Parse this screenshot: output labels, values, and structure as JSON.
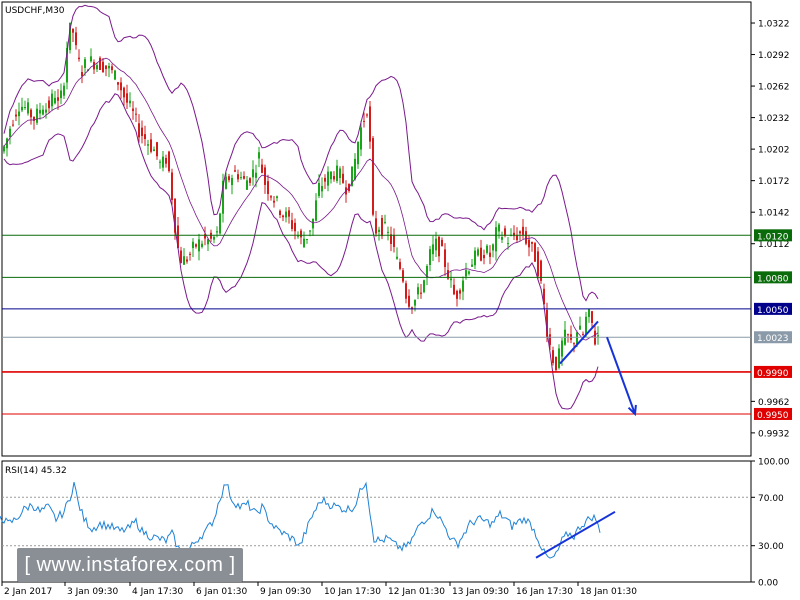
{
  "symbol": "USDCHF,M30",
  "watermark": "[  www.instaforex.com ]",
  "colors": {
    "candle_up": "#1aa51a",
    "candle_down": "#d21d1d",
    "bollinger": "#7a1a8c",
    "rsi": "#1f82d6",
    "arrow": "#1633d9",
    "support_red": "#e00000",
    "resistance_green": "#0a6b0a",
    "pivot_navy": "#00008b",
    "price_gray": "#8a9aa8"
  },
  "chart_data": [
    {
      "type": "candlestick",
      "title": "USDCHF,M30",
      "ylim": [
        0.991,
        1.0342
      ],
      "y_ticks": [
        "1.0322",
        "1.0292",
        "1.0262",
        "1.0232",
        "1.0202",
        "1.0172",
        "1.0142",
        "1.0112",
        "0.9962",
        "0.9932"
      ],
      "x_labels": [
        "2 Jan 2017",
        "3 Jan 09:30",
        "4 Jan 17:30",
        "6 Jan 01:30",
        "9 Jan 09:30",
        "10 Jan 17:30",
        "12 Jan 01:30",
        "13 Jan 09:30",
        "16 Jan 17:30",
        "18 Jan 01:30"
      ],
      "price_anchors": [
        [
          0,
          1.0185
        ],
        [
          4,
          1.02
        ],
        [
          8,
          1.0205
        ],
        [
          15,
          1.023
        ],
        [
          22,
          1.0245
        ],
        [
          30,
          1.024
        ],
        [
          38,
          1.023
        ],
        [
          45,
          1.0245
        ],
        [
          50,
          1.024
        ],
        [
          58,
          1.0255
        ],
        [
          62,
          1.024
        ],
        [
          67,
          1.027
        ],
        [
          71,
          1.031
        ],
        [
          75,
          1.032
        ],
        [
          79,
          1.0295
        ],
        [
          84,
          1.0275
        ],
        [
          90,
          1.0285
        ],
        [
          98,
          1.0285
        ],
        [
          106,
          1.0282
        ],
        [
          115,
          1.0275
        ],
        [
          122,
          1.0265
        ],
        [
          128,
          1.025
        ],
        [
          136,
          1.0235
        ],
        [
          142,
          1.022
        ],
        [
          150,
          1.021
        ],
        [
          158,
          1.02
        ],
        [
          164,
          1.0185
        ],
        [
          170,
          1.0195
        ],
        [
          176,
          1.015
        ],
        [
          180,
          1.011
        ],
        [
          185,
          1.0095
        ],
        [
          192,
          1.01
        ],
        [
          198,
          1.011
        ],
        [
          206,
          1.0115
        ],
        [
          214,
          1.0115
        ],
        [
          220,
          1.012
        ],
        [
          226,
          1.0165
        ],
        [
          232,
          1.0175
        ],
        [
          240,
          1.018
        ],
        [
          248,
          1.017
        ],
        [
          256,
          1.018
        ],
        [
          262,
          1.0195
        ],
        [
          268,
          1.017
        ],
        [
          274,
          1.016
        ],
        [
          280,
          1.015
        ],
        [
          286,
          1.014
        ],
        [
          292,
          1.0135
        ],
        [
          298,
          1.0125
        ],
        [
          304,
          1.0115
        ],
        [
          310,
          1.012
        ],
        [
          316,
          1.0135
        ],
        [
          322,
          1.0165
        ],
        [
          330,
          1.0175
        ],
        [
          336,
          1.018
        ],
        [
          342,
          1.0178
        ],
        [
          350,
          1.0165
        ],
        [
          356,
          1.018
        ],
        [
          362,
          1.0215
        ],
        [
          368,
          1.0235
        ],
        [
          372,
          1.025
        ],
        [
          374,
          1.016
        ],
        [
          377,
          1.012
        ],
        [
          381,
          1.013
        ],
        [
          388,
          1.0125
        ],
        [
          394,
          1.0115
        ],
        [
          400,
          1.0095
        ],
        [
          405,
          1.0085
        ],
        [
          410,
          1.006
        ],
        [
          416,
          1.0055
        ],
        [
          422,
          1.0065
        ],
        [
          428,
          1.008
        ],
        [
          434,
          1.0105
        ],
        [
          440,
          1.0112
        ],
        [
          446,
          1.01
        ],
        [
          452,
          1.008
        ],
        [
          458,
          1.006
        ],
        [
          462,
          1.007
        ],
        [
          468,
          1.0085
        ],
        [
          474,
          1.0095
        ],
        [
          480,
          1.01
        ],
        [
          488,
          1.0105
        ],
        [
          494,
          1.01
        ],
        [
          500,
          1.0125
        ],
        [
          506,
          1.012
        ],
        [
          512,
          1.0115
        ],
        [
          518,
          1.012
        ],
        [
          526,
          1.0122
        ],
        [
          532,
          1.011
        ],
        [
          538,
          1.01
        ],
        [
          542,
          1.0085
        ],
        [
          546,
          1.006
        ],
        [
          550,
          1.003
        ],
        [
          554,
          1.001
        ],
        [
          558,
          0.9995
        ],
        [
          562,
          1.0005
        ],
        [
          566,
          1.002
        ],
        [
          570,
          1.0025
        ],
        [
          575,
          1.0015
        ],
        [
          580,
          1.003
        ],
        [
          586,
          1.0025
        ],
        [
          590,
          1.0045
        ],
        [
          594,
          1.004
        ],
        [
          598,
          1.002
        ],
        [
          600,
          1.0025
        ]
      ],
      "horizontal_levels": [
        {
          "label": "1.0120",
          "price": 1.012,
          "role": "resistance",
          "color": "#0a6b0a"
        },
        {
          "label": "1.0080",
          "price": 1.008,
          "role": "resistance",
          "color": "#0a6b0a"
        },
        {
          "label": "1.0050",
          "price": 1.005,
          "role": "pivot",
          "color": "#00008b"
        },
        {
          "label": "1.0023",
          "price": 1.0023,
          "role": "current",
          "color": "#8a9aa8"
        },
        {
          "label": "0.9990",
          "price": 0.999,
          "role": "support",
          "color": "#e00000"
        },
        {
          "label": "0.9950",
          "price": 0.995,
          "role": "support",
          "color": "#e00000"
        }
      ],
      "trendline": {
        "x": [
          560,
          598
        ],
        "price": [
          0.9998,
          1.0038
        ]
      },
      "forecast_arrow": {
        "x": [
          607,
          635
        ],
        "price": [
          1.0023,
          0.995
        ]
      }
    },
    {
      "type": "line",
      "title": "RSI(14) 45.32",
      "ylim": [
        0,
        100
      ],
      "y_ticks": [
        "100.00",
        "70.00",
        "30.00",
        "0.00"
      ],
      "dotted_levels": [
        70,
        30
      ],
      "trendline": {
        "x": [
          536,
          615
        ],
        "value": [
          20,
          58
        ]
      },
      "series_anchors": [
        [
          0,
          55
        ],
        [
          8,
          48
        ],
        [
          16,
          52
        ],
        [
          24,
          60
        ],
        [
          32,
          64
        ],
        [
          40,
          58
        ],
        [
          48,
          62
        ],
        [
          56,
          52
        ],
        [
          64,
          58
        ],
        [
          70,
          70
        ],
        [
          74,
          82
        ],
        [
          78,
          66
        ],
        [
          84,
          52
        ],
        [
          92,
          44
        ],
        [
          100,
          48
        ],
        [
          110,
          46
        ],
        [
          120,
          42
        ],
        [
          128,
          44
        ],
        [
          136,
          50
        ],
        [
          142,
          42
        ],
        [
          150,
          38
        ],
        [
          158,
          36
        ],
        [
          166,
          34
        ],
        [
          172,
          40
        ],
        [
          178,
          28
        ],
        [
          184,
          22
        ],
        [
          192,
          30
        ],
        [
          198,
          36
        ],
        [
          206,
          42
        ],
        [
          214,
          52
        ],
        [
          220,
          70
        ],
        [
          226,
          82
        ],
        [
          232,
          68
        ],
        [
          240,
          62
        ],
        [
          248,
          64
        ],
        [
          256,
          56
        ],
        [
          262,
          62
        ],
        [
          270,
          50
        ],
        [
          276,
          44
        ],
        [
          284,
          40
        ],
        [
          292,
          36
        ],
        [
          300,
          30
        ],
        [
          306,
          42
        ],
        [
          314,
          58
        ],
        [
          322,
          68
        ],
        [
          330,
          64
        ],
        [
          338,
          62
        ],
        [
          346,
          60
        ],
        [
          354,
          62
        ],
        [
          362,
          78
        ],
        [
          366,
          84
        ],
        [
          370,
          58
        ],
        [
          374,
          36
        ],
        [
          380,
          34
        ],
        [
          388,
          36
        ],
        [
          396,
          30
        ],
        [
          402,
          28
        ],
        [
          408,
          30
        ],
        [
          414,
          38
        ],
        [
          420,
          48
        ],
        [
          428,
          54
        ],
        [
          434,
          60
        ],
        [
          440,
          52
        ],
        [
          446,
          44
        ],
        [
          452,
          34
        ],
        [
          458,
          32
        ],
        [
          464,
          40
        ],
        [
          470,
          48
        ],
        [
          478,
          52
        ],
        [
          486,
          50
        ],
        [
          492,
          48
        ],
        [
          500,
          56
        ],
        [
          506,
          52
        ],
        [
          512,
          46
        ],
        [
          518,
          50
        ],
        [
          526,
          52
        ],
        [
          532,
          46
        ],
        [
          538,
          36
        ],
        [
          544,
          24
        ],
        [
          550,
          18
        ],
        [
          556,
          22
        ],
        [
          562,
          34
        ],
        [
          568,
          40
        ],
        [
          574,
          38
        ],
        [
          580,
          46
        ],
        [
          586,
          50
        ],
        [
          592,
          54
        ],
        [
          596,
          52
        ],
        [
          600,
          40
        ]
      ]
    }
  ]
}
